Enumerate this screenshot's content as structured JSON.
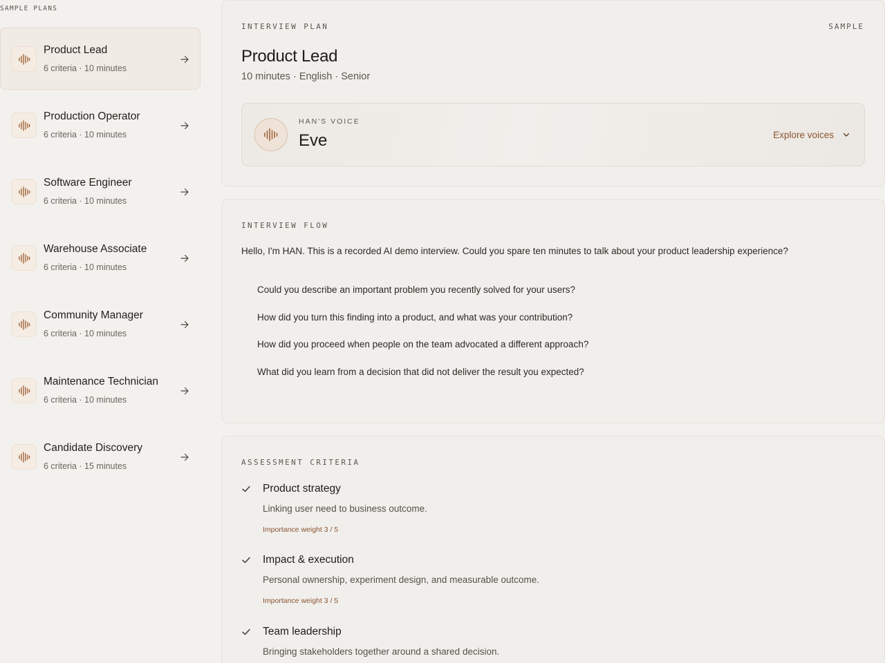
{
  "sidebar": {
    "heading": "SAMPLE PLANS",
    "items": [
      {
        "title": "Product Lead",
        "meta": "6 criteria · 10 minutes"
      },
      {
        "title": "Production Operator",
        "meta": "6 criteria · 10 minutes"
      },
      {
        "title": "Software Engineer",
        "meta": "6 criteria · 10 minutes"
      },
      {
        "title": "Warehouse Associate",
        "meta": "6 criteria · 10 minutes"
      },
      {
        "title": "Community Manager",
        "meta": "6 criteria · 10 minutes"
      },
      {
        "title": "Maintenance Technician",
        "meta": "6 criteria · 10 minutes"
      },
      {
        "title": "Candidate Discovery",
        "meta": "6 criteria · 15 minutes"
      }
    ],
    "active_index": 0
  },
  "plan": {
    "section_label": "INTERVIEW PLAN",
    "badge": "SAMPLE",
    "title": "Product Lead",
    "subtitle": "10 minutes · English · Senior",
    "voice": {
      "label": "HAN'S VOICE",
      "name": "Eve",
      "explore_label": "Explore voices"
    }
  },
  "flow": {
    "section_label": "INTERVIEW FLOW",
    "intro": "Hello, I'm HAN. This is a recorded AI demo interview. Could you spare ten minutes to talk about your product leadership experience?",
    "questions": [
      "Could you describe an important problem you recently solved for your users?",
      "How did you turn this finding into a product, and what was your contribution?",
      "How did you proceed when people on the team advocated a different approach?",
      "What did you learn from a decision that did not deliver the result you expected?"
    ]
  },
  "criteria": {
    "section_label": "ASSESSMENT CRITERIA",
    "items": [
      {
        "title": "Product strategy",
        "description": "Linking user need to business outcome.",
        "weight": "Importance weight 3 / 5"
      },
      {
        "title": "Impact & execution",
        "description": "Personal ownership, experiment design, and measurable outcome.",
        "weight": "Importance weight 3 / 5"
      },
      {
        "title": "Team leadership",
        "description": "Bringing stakeholders together around a shared decision.",
        "weight": ""
      }
    ]
  },
  "colors": {
    "accent": "#8a5430",
    "icon_brown": "#a0653b",
    "background": "#f3f1ee"
  },
  "icons": {
    "plan_icon": "soundwave-icon",
    "arrow": "arrow-right-icon",
    "dropdown": "chevron-down-icon",
    "criterion": "check-icon"
  }
}
